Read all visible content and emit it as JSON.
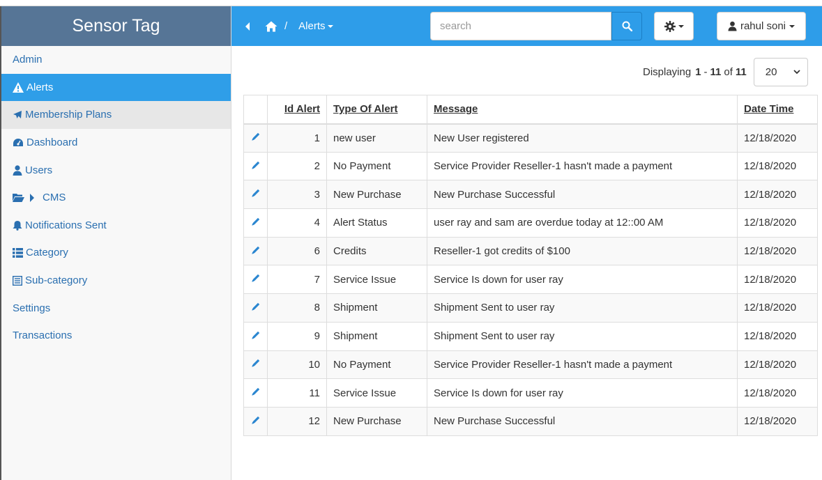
{
  "app": {
    "brand": "Sensor Tag"
  },
  "sidebar": {
    "items": [
      {
        "label": "Admin",
        "icon": ""
      },
      {
        "label": "Alerts",
        "icon": "warning-icon"
      },
      {
        "label": "Membership Plans",
        "icon": "plane-icon"
      },
      {
        "label": "Dashboard",
        "icon": "dashboard-icon"
      },
      {
        "label": "Users",
        "icon": "user-icon"
      },
      {
        "label": "CMS",
        "icon": "folder-open-icon"
      },
      {
        "label": "Notifications Sent",
        "icon": "bell-icon"
      },
      {
        "label": "Category",
        "icon": "list-icon"
      },
      {
        "label": "Sub-category",
        "icon": "list-alt-icon"
      },
      {
        "label": "Settings",
        "icon": ""
      },
      {
        "label": "Transactions",
        "icon": ""
      }
    ]
  },
  "header": {
    "breadcrumb_sep": "/",
    "breadcrumb_current": "Alerts",
    "search": {
      "placeholder": "search",
      "value": ""
    },
    "user_name": "rahul soni"
  },
  "pager": {
    "prefix": "Displaying",
    "from": "1",
    "dash": "-",
    "to": "11",
    "of": "of",
    "total": "11",
    "page_size": "20"
  },
  "table": {
    "columns": [
      "Id Alert",
      "Type Of Alert",
      "Message",
      "Date Time"
    ],
    "rows": [
      {
        "id": "1",
        "type": "new user",
        "message": "New User registered",
        "date": "12/18/2020"
      },
      {
        "id": "2",
        "type": "No Payment",
        "message": "Service Provider Reseller-1 hasn't made a payment",
        "date": "12/18/2020"
      },
      {
        "id": "3",
        "type": "New Purchase",
        "message": "New Purchase Successful",
        "date": "12/18/2020"
      },
      {
        "id": "4",
        "type": "Alert Status",
        "message": "user ray and sam are overdue today at 12::00 AM",
        "date": "12/18/2020"
      },
      {
        "id": "6",
        "type": "Credits",
        "message": "Reseller-1 got credits of $100",
        "date": "12/18/2020"
      },
      {
        "id": "7",
        "type": "Service Issue",
        "message": "Service Is down for user ray",
        "date": "12/18/2020"
      },
      {
        "id": "8",
        "type": "Shipment",
        "message": "Shipment Sent to user ray",
        "date": "12/18/2020"
      },
      {
        "id": "9",
        "type": "Shipment",
        "message": "Shipment Sent to user ray",
        "date": "12/18/2020"
      },
      {
        "id": "10",
        "type": "No Payment",
        "message": "Service Provider Reseller-1 hasn't made a payment",
        "date": "12/18/2020"
      },
      {
        "id": "11",
        "type": "Service Issue",
        "message": "Service Is down for user ray",
        "date": "12/18/2020"
      },
      {
        "id": "12",
        "type": "New Purchase",
        "message": "New Purchase Successful",
        "date": "12/18/2020"
      }
    ]
  },
  "colors": {
    "brand_bg": "#567596",
    "header_bg": "#2e9de9",
    "active_item": "#2f9ee8",
    "link": "#2a6fb0"
  }
}
